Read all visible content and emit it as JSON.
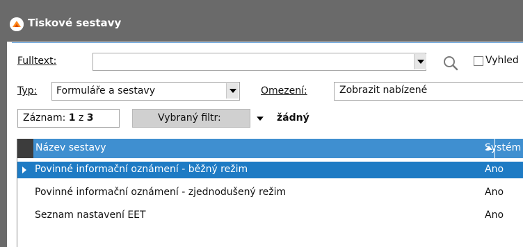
{
  "window": {
    "title": "Tiskové sestavy"
  },
  "filters": {
    "fulltext_label": "Fulltext:",
    "fulltext_value": "",
    "vyhledavat_label": "Vyhled",
    "typ_label": "Typ:",
    "typ_value": "Formuláře a sestavy",
    "omezeni_label": "Omezení:",
    "omezeni_value": "Zobrazit nabízené"
  },
  "record": {
    "prefix": "Záznam:",
    "current": "1",
    "sep": "z",
    "total": "3"
  },
  "filter": {
    "label": "Vybraný filtr:",
    "value": "žádný"
  },
  "grid": {
    "columns": [
      "Název sestavy",
      "Systém"
    ],
    "sorted_column": "Název sestavy",
    "sort_direction": "ascending",
    "rows": [
      {
        "name": "Povinné informační oznámení - běžný režim",
        "system": "Ano",
        "selected": true
      },
      {
        "name": "Povinné informační oznámení - zjednodušený režim",
        "system": "Ano",
        "selected": false
      },
      {
        "name": "Seznam nastavení EET",
        "system": "Ano",
        "selected": false
      }
    ]
  },
  "colors": {
    "titlebar": "#6a6a6a",
    "header": "#3f8fd0",
    "selection": "#1e7bc4"
  }
}
